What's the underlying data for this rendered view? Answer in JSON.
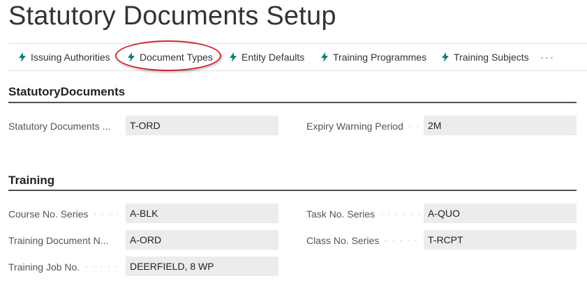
{
  "page": {
    "title": "Statutory Documents Setup"
  },
  "actions": [
    {
      "label": "Issuing Authorities",
      "icon": "lightning-icon"
    },
    {
      "label": "Document Types",
      "icon": "lightning-icon"
    },
    {
      "label": "Entity Defaults",
      "icon": "lightning-icon"
    },
    {
      "label": "Training Programmes",
      "icon": "lightning-icon"
    },
    {
      "label": "Training Subjects",
      "icon": "lightning-icon"
    }
  ],
  "more_label": "···",
  "sections": {
    "statutory": {
      "title": "StatutoryDocuments",
      "fields": {
        "statutory_documents": {
          "label": "Statutory Documents ...",
          "value": "T-ORD"
        },
        "expiry_warning_period": {
          "label": "Expiry Warning Period",
          "value": "2M"
        }
      }
    },
    "training": {
      "title": "Training",
      "fields": {
        "course_no_series": {
          "label": "Course No. Series",
          "value": "A-BLK"
        },
        "task_no_series": {
          "label": "Task No. Series",
          "value": "A-QUO"
        },
        "training_document_no": {
          "label": "Training Document N...",
          "value": "A-ORD"
        },
        "class_no_series": {
          "label": "Class No. Series",
          "value": "T-RCPT"
        },
        "training_job_no": {
          "label": "Training Job No.",
          "value": "DEERFIELD, 8 WP"
        }
      }
    }
  },
  "colors": {
    "accent": "#00857c",
    "highlight": "#d0262a",
    "field_bg": "#ececec"
  }
}
